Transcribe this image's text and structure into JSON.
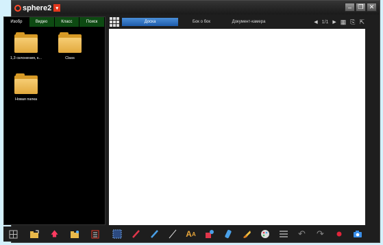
{
  "app": {
    "title": "sphere2"
  },
  "left_panel": {
    "tabs": [
      {
        "label": "Изобр",
        "active": true
      },
      {
        "label": "Видео",
        "active": false
      },
      {
        "label": "Класс",
        "active": false
      },
      {
        "label": "Поиск",
        "active": false
      }
    ],
    "files": [
      {
        "name": "1,3 склонения, к..."
      },
      {
        "name": "Class"
      },
      {
        "name": "Новая папка"
      }
    ]
  },
  "view_modes": [
    {
      "label": "Доска",
      "active": true
    },
    {
      "label": "Бок о бок",
      "active": false
    },
    {
      "label": "Документ-камера",
      "active": false
    }
  ],
  "pager": {
    "text": "1/1"
  },
  "colors": {
    "accent": "#e2371d",
    "active_tab": "#1e5cab",
    "folder": "#f0c060"
  },
  "icons_left_toolbar": [
    "layout-icon",
    "import-icon",
    "upload-icon",
    "new-folder-icon",
    "list-icon"
  ],
  "icons_bottom_toolbar": [
    "select-icon",
    "red-pen-icon",
    "blue-pen-icon",
    "line-icon",
    "text-icon",
    "shapes-icon",
    "marker-icon",
    "eraser-icon",
    "palette-icon",
    "lines-icon",
    "undo-icon",
    "redo-icon",
    "record-icon",
    "camera-icon"
  ]
}
